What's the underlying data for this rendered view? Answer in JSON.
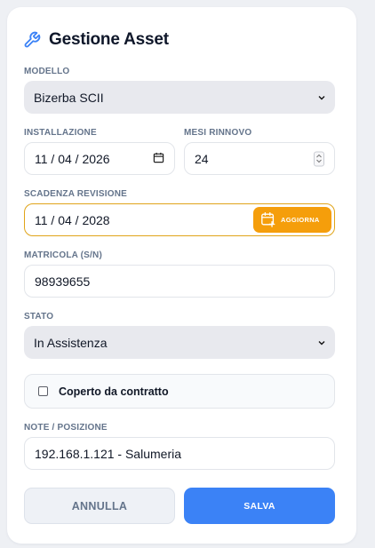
{
  "header": {
    "title": "Gestione Asset",
    "icon": "wrench-icon"
  },
  "fields": {
    "modello": {
      "label": "MODELLO",
      "value": "Bizerba SCII"
    },
    "installazione": {
      "label": "INSTALLAZIONE",
      "value": "11 / 04 / 2026"
    },
    "mesi_rinnovo": {
      "label": "MESI RINNOVO",
      "value": "24"
    },
    "scadenza": {
      "label": "SCADENZA REVISIONE",
      "value": "11 / 04 / 2028",
      "button": "AGGIORNA"
    },
    "matricola": {
      "label": "MATRICOLA (S/N)",
      "value": "98939655"
    },
    "stato": {
      "label": "STATO",
      "value": "In Assistenza"
    },
    "contratto": {
      "label": "Coperto da contratto",
      "checked": false
    },
    "note": {
      "label": "NOTE / POSIZIONE",
      "value": "192.168.1.121 - Salumeria"
    }
  },
  "actions": {
    "cancel": "ANNULLA",
    "save": "SALVA"
  },
  "colors": {
    "accent": "#3b82f6",
    "warning": "#f59e0b",
    "title_icon": "#3b82f6"
  }
}
